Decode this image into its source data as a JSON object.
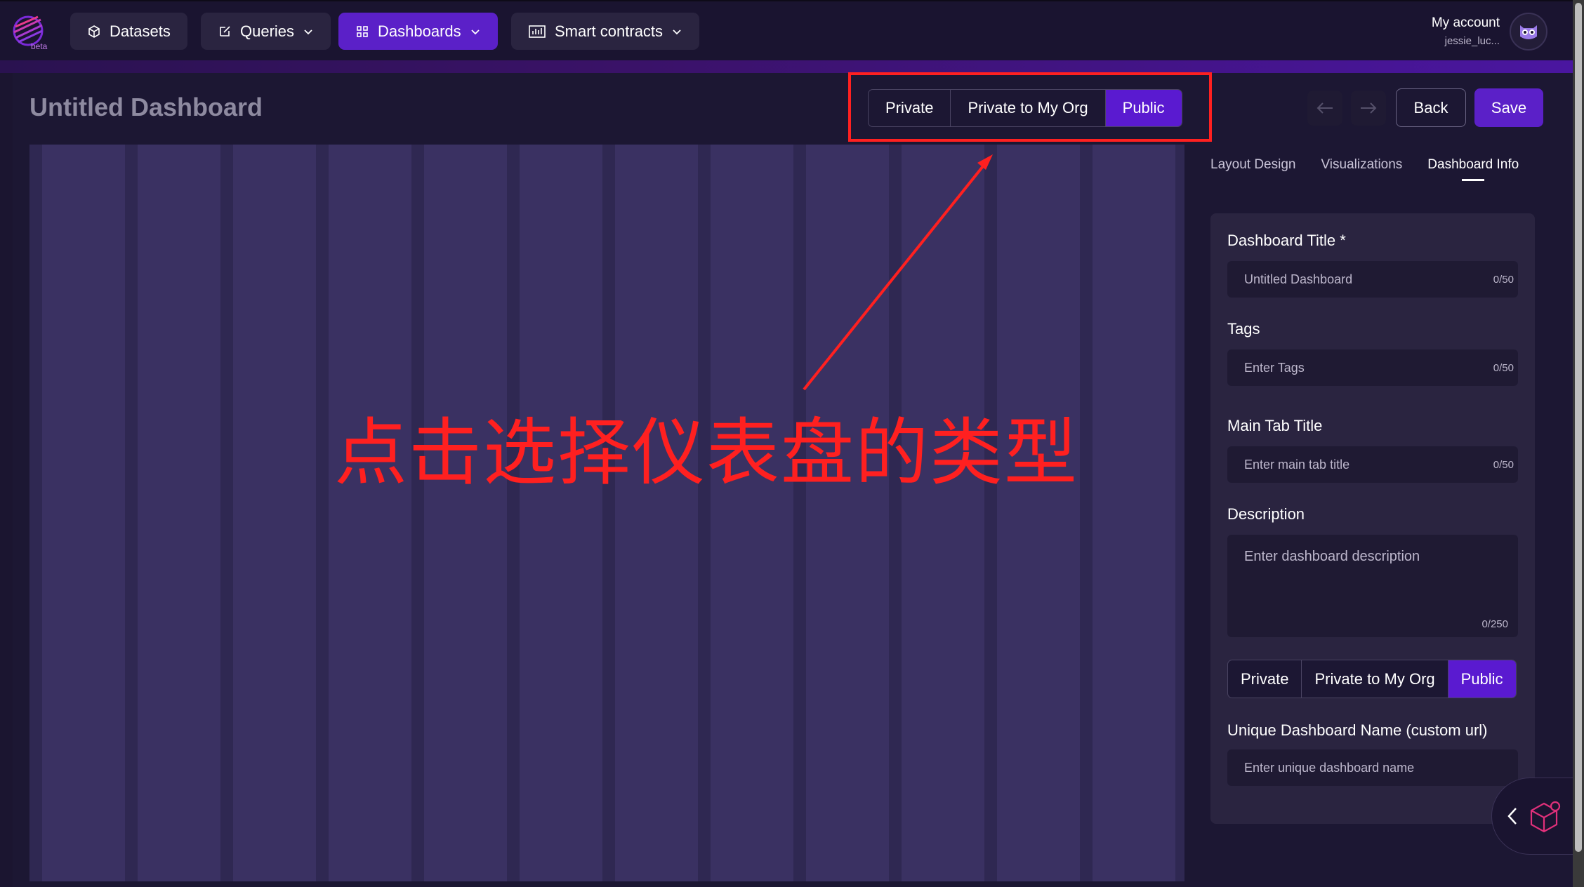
{
  "nav": {
    "logo_badge": "beta",
    "items": [
      {
        "label": "Datasets",
        "icon": "cube-icon"
      },
      {
        "label": "Queries",
        "icon": "edit-icon"
      },
      {
        "label": "Dashboards",
        "icon": "grid-icon"
      },
      {
        "label": "Smart contracts",
        "icon": "chart-icon"
      }
    ],
    "active": "Dashboards",
    "account_label": "My account",
    "account_user": "jessie_luc..."
  },
  "header": {
    "title": "Untitled Dashboard",
    "visibility_options": [
      "Private",
      "Private to My Org",
      "Public"
    ],
    "visibility_selected": "Public",
    "back_label": "Back",
    "save_label": "Save"
  },
  "annotation": {
    "text": "点击选择仪表盘的类型",
    "color": "#ff2020"
  },
  "sidebar": {
    "tabs": [
      "Layout Design",
      "Visualizations",
      "Dashboard Info"
    ],
    "active_tab": "Dashboard Info",
    "fields": {
      "title_label": "Dashboard Title *",
      "title_placeholder": "Untitled Dashboard",
      "title_count": "0/50",
      "tags_label": "Tags",
      "tags_placeholder": "Enter Tags",
      "tags_count": "0/50",
      "main_tab_label": "Main Tab Title",
      "main_tab_placeholder": "Enter main tab title",
      "main_tab_count": "0/50",
      "description_label": "Description",
      "description_placeholder": "Enter dashboard description",
      "description_count": "0/250",
      "unique_name_label": "Unique Dashboard Name (custom url)",
      "unique_name_placeholder": "Enter unique dashboard name"
    },
    "visibility_options": [
      "Private",
      "Private to My Org",
      "Public"
    ],
    "visibility_selected": "Public"
  },
  "colors": {
    "accent": "#5b20c8",
    "background": "#1c1733",
    "canvas": "#2f2852"
  }
}
